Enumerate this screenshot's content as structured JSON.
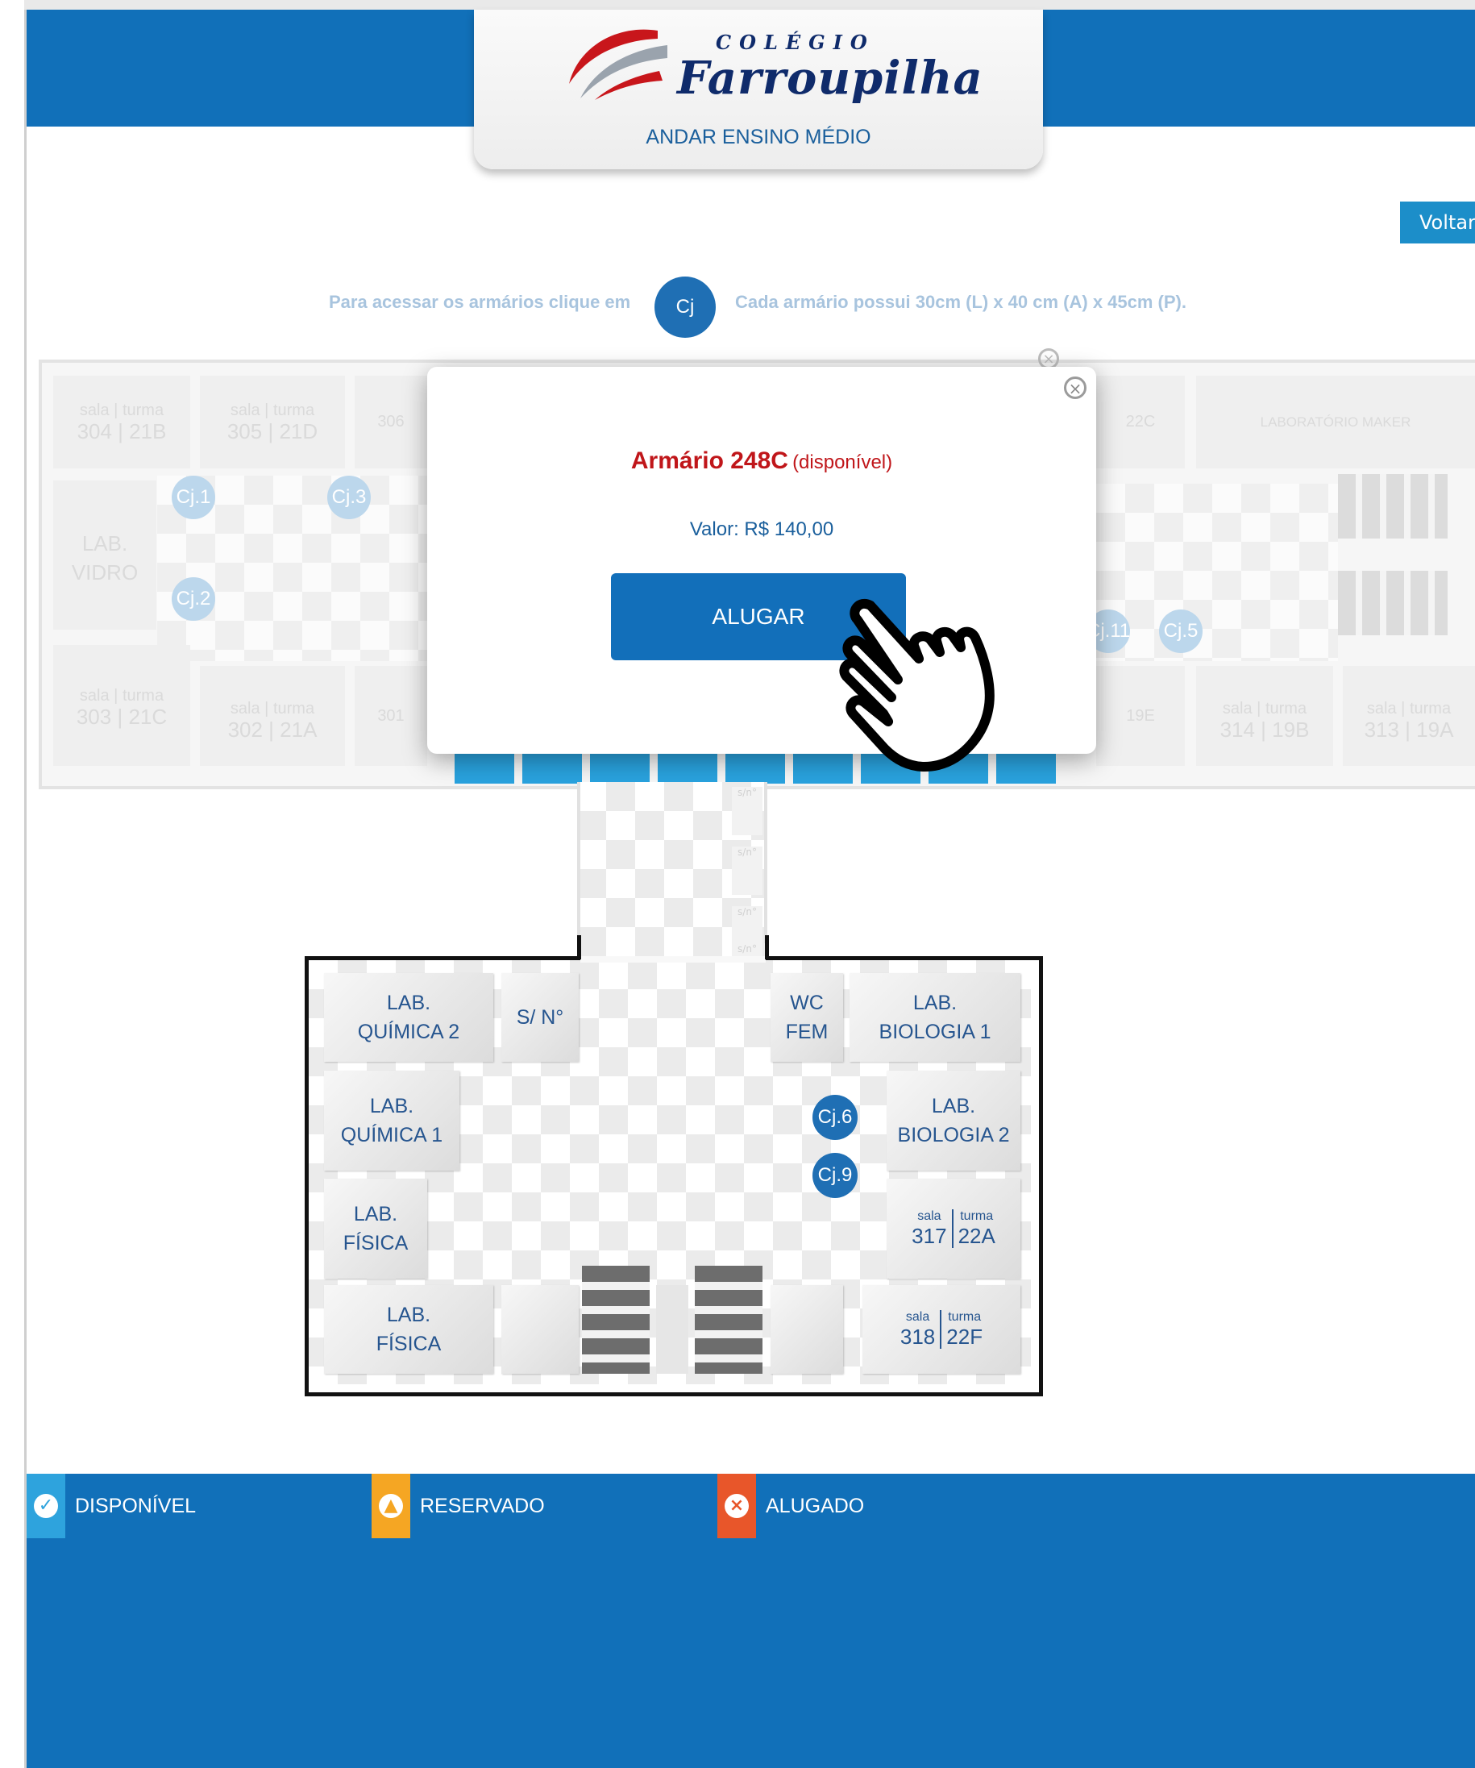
{
  "header": {
    "logo_top": "COLÉGIO",
    "logo_name": "Farroupilha",
    "subtitle": "ANDAR ENSINO MÉDIO"
  },
  "nav": {
    "back_label": "Voltar"
  },
  "instructions": {
    "left_text": "Para acessar os armários clique em",
    "badge": "Cj",
    "right_text": "Cada armário possui 30cm (L) x 40 cm (A) x 45cm (P)."
  },
  "upper_floor": {
    "rooms": [
      {
        "sala": "304",
        "turma": "21B"
      },
      {
        "sala": "305",
        "turma": "21D"
      },
      {
        "sala": "303",
        "turma": "21C"
      },
      {
        "sala": "302",
        "turma": "21A"
      },
      {
        "sala": "314",
        "turma": "19B"
      },
      {
        "sala": "313",
        "turma": "19A"
      }
    ],
    "lab_vidro": "LAB. VIDRO",
    "lab_maker": "LABORATÓRIO MAKER",
    "sala_labels": {
      "sala": "sala",
      "turma": "turma"
    },
    "partial": [
      "306",
      "301",
      "22C",
      "19E"
    ],
    "clusters": [
      "Cj.1",
      "Cj.3",
      "Cj.2",
      "Cj.11",
      "Cj.5"
    ]
  },
  "modal": {
    "title": "Armário 248C",
    "status": "(disponível)",
    "price_label": "Valor: R$ 140,00",
    "action_label": "ALUGAR"
  },
  "lower_floor": {
    "rooms": {
      "lab_quimica2": [
        "LAB.",
        "QUÍMICA 2"
      ],
      "lab_quimica1": [
        "LAB.",
        "QUÍMICA 1"
      ],
      "lab_fisica_a": [
        "LAB.",
        "FÍSICA"
      ],
      "lab_fisica_b": [
        "LAB.",
        "FÍSICA"
      ],
      "sn": "S/ N°",
      "wc_fem": [
        "WC",
        "FEM"
      ],
      "lab_biologia1": [
        "LAB.",
        "BIOLOGIA 1"
      ],
      "lab_biologia2": [
        "LAB.",
        "BIOLOGIA 2"
      ],
      "room_317": {
        "sala": "317",
        "turma": "22A"
      },
      "room_318": {
        "sala": "318",
        "turma": "22F"
      }
    },
    "clusters": [
      "Cj.6",
      "Cj.9"
    ],
    "sn_small": "s/n°"
  },
  "legend": {
    "items": [
      {
        "label": "DISPONÍVEL",
        "color": "#2ea3dd"
      },
      {
        "label": "RESERVADO",
        "color": "#f5a623"
      },
      {
        "label": "ALUGADO",
        "color": "#e8562a"
      }
    ]
  },
  "colors": {
    "primary": "#1170b9",
    "accent": "#29a2de",
    "alert": "#c0161a"
  }
}
